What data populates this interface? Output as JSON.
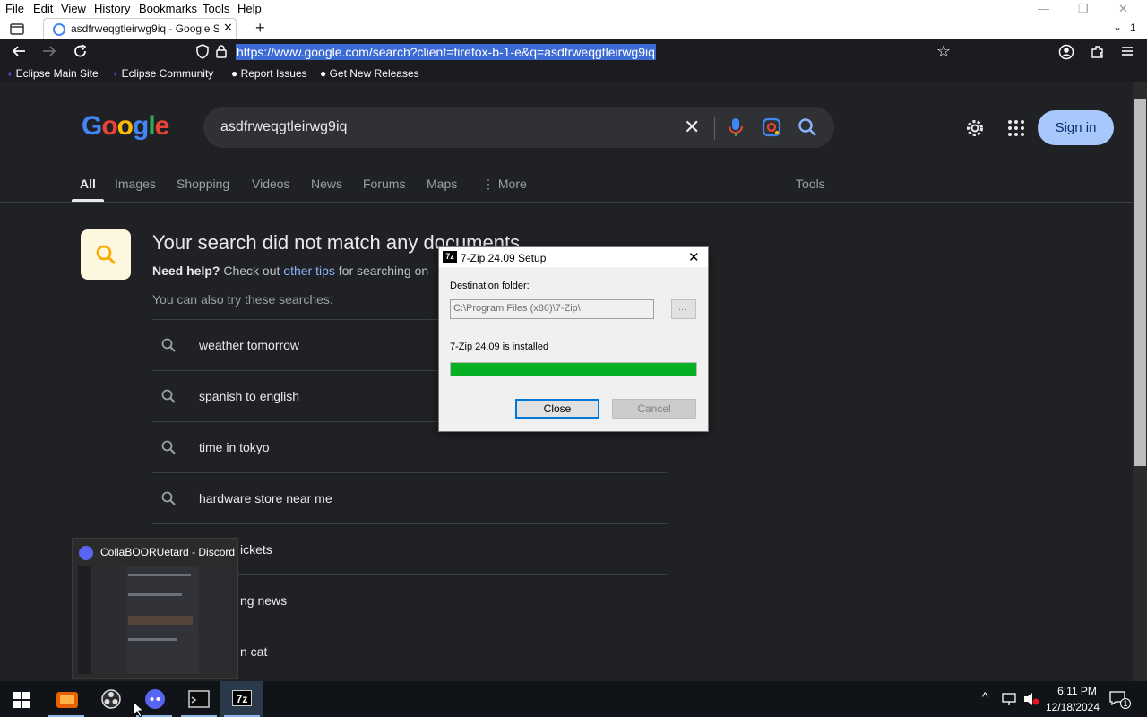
{
  "menu": {
    "items": [
      "File",
      "Edit",
      "View",
      "History",
      "Bookmarks",
      "Tools",
      "Help"
    ]
  },
  "tab": {
    "title": "asdfrweqgtleirwg9iq - Google Se",
    "overflow_count": "1"
  },
  "navbar": {
    "url": "https://www.google.com/search?client=firefox-b-1-e&q=asdfrweqgtleirwg9iq"
  },
  "bookmarks": [
    "Eclipse Main Site",
    "Eclipse Community",
    "Report Issues",
    "Get New Releases"
  ],
  "google": {
    "logo": "Google",
    "query": "asdfrweqgtleirwg9iq",
    "signin": "Sign in",
    "tabs": [
      "All",
      "Images",
      "Shopping",
      "Videos",
      "News",
      "Forums",
      "Maps",
      "More"
    ],
    "tools": "Tools",
    "not_found_title": "Your search did not match any documents",
    "need_help_bold": "Need help?",
    "need_help_text": "Check out",
    "need_help_link": "other tips",
    "need_help_tail": "for searching on",
    "also_try": "You can also try these searches:",
    "suggestions": [
      "weather tomorrow",
      "spanish to english",
      "time in tokyo",
      "hardware store near me",
      "ickets",
      "ng news",
      "n cat"
    ]
  },
  "dialog": {
    "title": "7-Zip 24.09 Setup",
    "dest_label": "Destination folder:",
    "dest_value": "C:\\Program Files (x86)\\7-Zip\\",
    "browse_label": "...",
    "status": "7-Zip 24.09 is installed",
    "progress": 1.0,
    "close_label": "Close",
    "cancel_label": "Cancel"
  },
  "preview": {
    "title": "CollaBOORUetard - Discord"
  },
  "taskbar": {
    "time": "6:11 PM",
    "date": "12/18/2024",
    "notif_count": "1",
    "seven_zip_label": "7z"
  },
  "colors": {
    "progress": "#06b025",
    "accent": "#0078d7",
    "google_bg": "#202124"
  }
}
